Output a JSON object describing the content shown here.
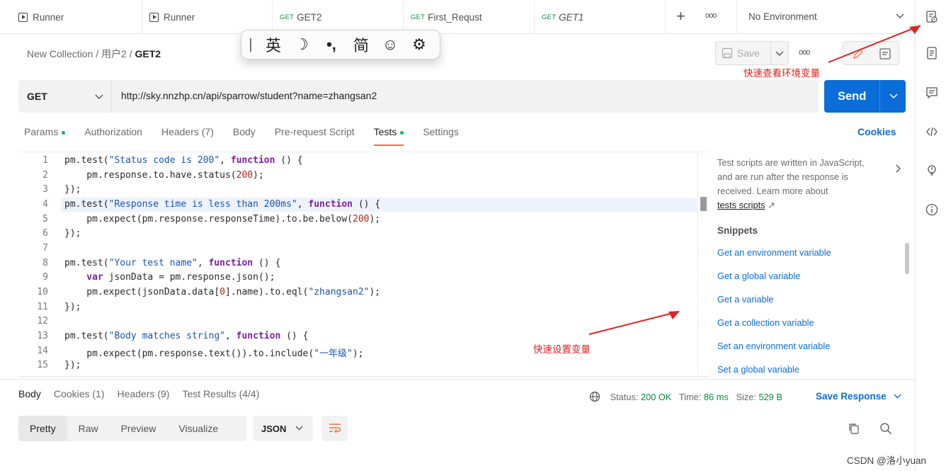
{
  "tabs": [
    {
      "method": "",
      "label": "Runner",
      "icon": "runner-icon"
    },
    {
      "method": "",
      "label": "Runner",
      "icon": "runner-icon"
    },
    {
      "method": "GET",
      "label": "GET2"
    },
    {
      "method": "GET",
      "label": "First_Requst"
    },
    {
      "method": "GET",
      "label": "GET1"
    }
  ],
  "tabbar": {
    "add": "+",
    "more": "ooo",
    "environment": "No Environment"
  },
  "breadcrumb": {
    "collection": "New Collection",
    "folder": "用户2",
    "request": "GET2",
    "sep": "/"
  },
  "ime_toolbar": {
    "cursor": "|",
    "lang": "英",
    "moon": "☽",
    "punct": "•,",
    "simp": "简",
    "emoji": "☺",
    "settings": "⚙"
  },
  "actions": {
    "save": "Save",
    "more": "ooo"
  },
  "request": {
    "method": "GET",
    "url": "http://sky.nnzhp.cn/api/sparrow/student?name=zhangsan2",
    "send": "Send"
  },
  "req_tabs": [
    {
      "label": "Params",
      "dot": true
    },
    {
      "label": "Authorization",
      "dot": false
    },
    {
      "label": "Headers (7)",
      "dot": false
    },
    {
      "label": "Body",
      "dot": false
    },
    {
      "label": "Pre-request Script",
      "dot": false
    },
    {
      "label": "Tests",
      "dot": true,
      "active": true
    },
    {
      "label": "Settings",
      "dot": false
    }
  ],
  "cookies": "Cookies",
  "code_lines": [
    {
      "n": "1"
    },
    {
      "n": "2"
    },
    {
      "n": "3"
    },
    {
      "n": "4"
    },
    {
      "n": "5"
    },
    {
      "n": "6"
    },
    {
      "n": "7"
    },
    {
      "n": "8"
    },
    {
      "n": "9"
    },
    {
      "n": "10"
    },
    {
      "n": "11"
    },
    {
      "n": "12"
    },
    {
      "n": "13"
    },
    {
      "n": "14"
    },
    {
      "n": "15"
    }
  ],
  "code": {
    "l1a": "pm.test(",
    "l1s": "\"Status code is 200\"",
    "l1c": ", ",
    "l1k": "function",
    "l1e": " () {",
    "l2a": "    pm.response.to.have.status(",
    "l2n": "200",
    "l2e": ");",
    "l3": "});",
    "l4a": "pm.test(",
    "l4s": "\"Response time is less than 200ms\"",
    "l4c": ", ",
    "l4k": "function",
    "l4e": " () {",
    "l5a": "    pm.expect(pm.response.responseTime).to.be.below(",
    "l5n": "200",
    "l5e": ");",
    "l6": "});",
    "l8a": "pm.test(",
    "l8s": "\"Your test name\"",
    "l8c": ", ",
    "l8k": "function",
    "l8e": " () {",
    "l9k": "    var",
    "l9e": " jsonData = pm.response.json();",
    "l10a": "    pm.expect(jsonData.data[",
    "l10n": "0",
    "l10b": "].name).to.eql(",
    "l10s": "\"zhangsan2\"",
    "l10e": ");",
    "l11": "});",
    "l13a": "pm.test(",
    "l13s": "\"Body matches string\"",
    "l13c": ", ",
    "l13k": "function",
    "l13e": " () {",
    "l14a": "    pm.expect(pm.response.text()).to.include(",
    "l14s": "\"一年级\"",
    "l14e": ");",
    "l15": "});"
  },
  "sidebar": {
    "desc1": "Test scripts are written in JavaScript,",
    "desc2": "and are run after the response is",
    "desc3": "received. Learn more about",
    "link": "tests scripts",
    "link_arrow": "↗",
    "snippets_title": "Snippets",
    "snippets": [
      "Get an environment variable",
      "Get a global variable",
      "Get a variable",
      "Get a collection variable",
      "Set an environment variable",
      "Set a global variable"
    ]
  },
  "response": {
    "tabs": [
      "Body",
      "Cookies (1)",
      "Headers (9)",
      "Test Results (4/4)"
    ],
    "status_label": "Status:",
    "status_value": "200 OK",
    "time_label": "Time:",
    "time_value": "86 ms",
    "size_label": "Size:",
    "size_value": "529 B",
    "save_response": "Save Response",
    "formats": [
      "Pretty",
      "Raw",
      "Preview",
      "Visualize"
    ],
    "json": "JSON"
  },
  "annotations": {
    "env_view": "快速查看环境变量",
    "set_var": "快速设置变量"
  },
  "watermark": "CSDN @洛小yuan",
  "colors": {
    "accent": "#0a6dd8",
    "tab_active": "#ff6c37",
    "annotation": "#e02020",
    "get": "#0b8a3e"
  }
}
